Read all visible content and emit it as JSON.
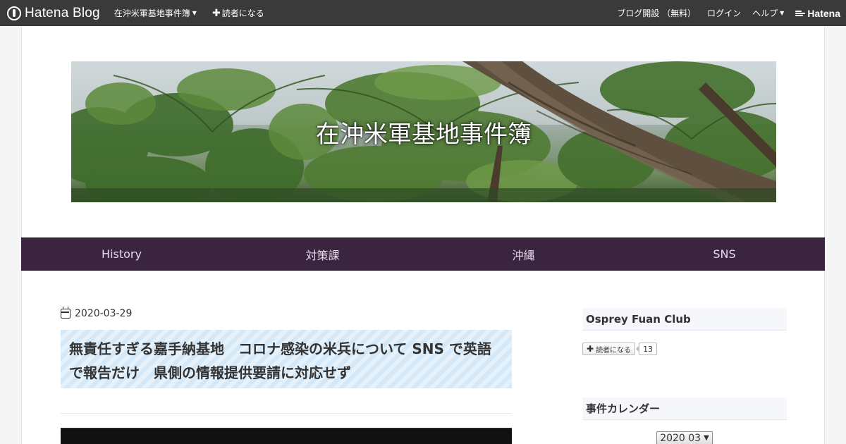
{
  "topbar": {
    "logo_text": "Hatena Blog",
    "blog_menu_label": "在沖米軍基地事件簿",
    "subscribe_label": "読者になる",
    "open_blog_label": "ブログ開設 （無料）",
    "login_label": "ログイン",
    "help_label": "ヘルプ",
    "hatena_label": "Hatena"
  },
  "header": {
    "blog_title": "在沖米軍基地事件簿"
  },
  "nav": {
    "items": [
      {
        "label": "History"
      },
      {
        "label": "対策課"
      },
      {
        "label": "沖縄"
      },
      {
        "label": "SNS"
      }
    ]
  },
  "article": {
    "date": "2020-03-29",
    "title": "無責任すぎる嘉手納基地　コロナ感染の米兵について SNS で英語で報告だけ　県側の情報提供要請に対応せず"
  },
  "sidebar": {
    "profile_title": "Osprey Fuan Club",
    "subscribe_label": "読者になる",
    "subscriber_count": "13",
    "calendar_title": "事件カレンダー",
    "calendar_selected": "2020 03"
  },
  "colors": {
    "topbar_bg": "#3a3a3a",
    "nav_bg": "#3b2440",
    "title_stripe": "#d4e8f7"
  }
}
